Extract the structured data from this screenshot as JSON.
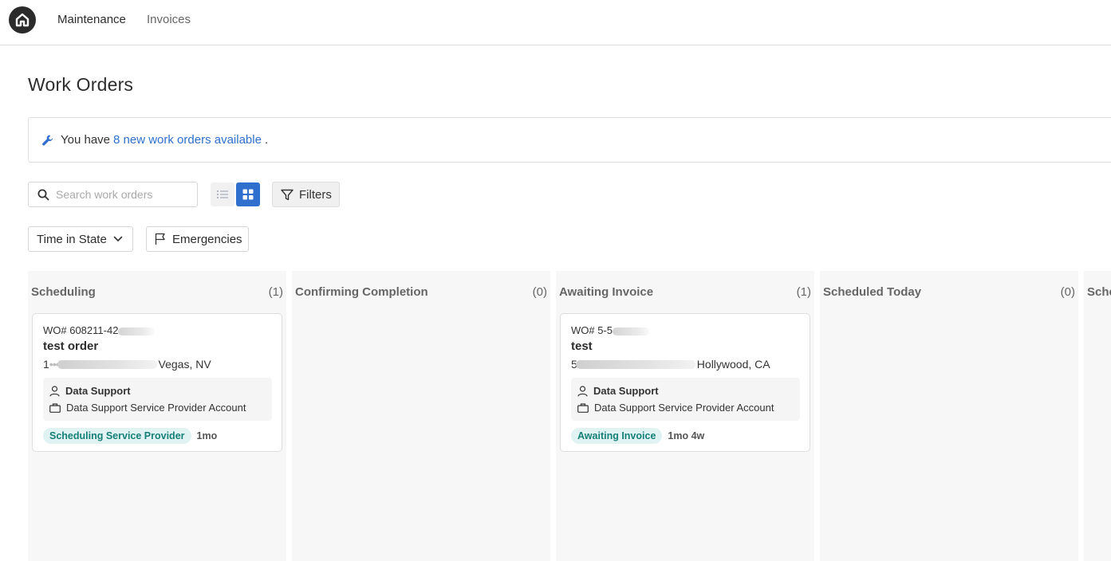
{
  "nav": {
    "logo_icon": "home-icon",
    "links": [
      "Maintenance",
      "Invoices"
    ]
  },
  "page": {
    "title": "Work Orders"
  },
  "banner": {
    "icon": "wrench-icon",
    "prefix": "You have",
    "link": "8 new work orders available",
    "suffix": "."
  },
  "toolbar": {
    "search_placeholder": "Search work orders",
    "filters_label": "Filters",
    "time_in_state_label": "Time in State",
    "emergencies_label": "Emergencies"
  },
  "columns": [
    {
      "title": "Scheduling",
      "count": "(1)"
    },
    {
      "title": "Confirming Completion",
      "count": "(0)"
    },
    {
      "title": "Awaiting Invoice",
      "count": "(1)"
    },
    {
      "title": "Scheduled Today",
      "count": "(0)"
    },
    {
      "title": "Sche",
      "count": ""
    }
  ],
  "cards": [
    {
      "wo": "WO# 608211-42",
      "title": "test order",
      "address_prefix": "1",
      "address_suffix": "Vegas, NV",
      "assignee": "Data Support",
      "account": "Data Support Service Provider Account",
      "status": "Scheduling Service Provider",
      "age": "1mo"
    },
    {
      "wo": "WO# 5-5",
      "title": "test",
      "address_prefix": "5",
      "address_suffix": "Hollywood, CA",
      "assignee": "Data Support",
      "account": "Data Support Service Provider Account",
      "status": "Awaiting Invoice",
      "age": "1mo 4w"
    }
  ],
  "colors": {
    "accent": "#2f6fce",
    "badge_bg": "#e0f3f2",
    "badge_text": "#157f78"
  }
}
